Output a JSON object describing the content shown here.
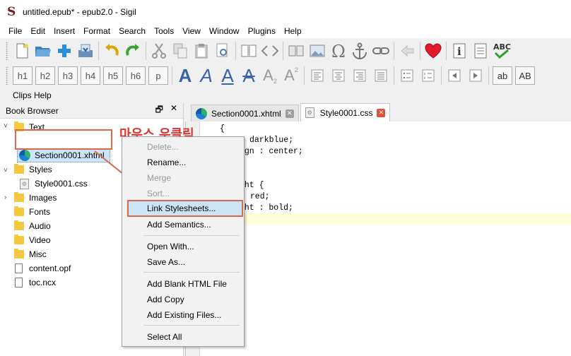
{
  "window": {
    "title": "untitled.epub* - epub2.0 - Sigil",
    "app_icon": "S"
  },
  "menubar": [
    "File",
    "Edit",
    "Insert",
    "Format",
    "Search",
    "Tools",
    "View",
    "Window",
    "Plugins",
    "Help"
  ],
  "toolbar2": {
    "headings": [
      "h1",
      "h2",
      "h3",
      "h4",
      "h5",
      "h6",
      "p"
    ],
    "a_glyph": "A",
    "sub_label": "2",
    "sup_label": "2",
    "ab_labels": [
      "ab",
      "AB"
    ]
  },
  "clips_bar": {
    "label": "Clips Help"
  },
  "book_browser": {
    "title": "Book Browser",
    "float_icon": "Ὕ7",
    "close_icon": "✕",
    "items": [
      {
        "label": "Text",
        "kind": "folder"
      },
      {
        "label": "Section0001.xhtml",
        "kind": "xhtml"
      },
      {
        "label": "Styles",
        "kind": "folder"
      },
      {
        "label": "Style0001.css",
        "kind": "css"
      },
      {
        "label": "Images",
        "kind": "folder"
      },
      {
        "label": "Fonts",
        "kind": "folder"
      },
      {
        "label": "Audio",
        "kind": "folder"
      },
      {
        "label": "Video",
        "kind": "folder"
      },
      {
        "label": "Misc",
        "kind": "folder"
      },
      {
        "label": "content.opf",
        "kind": "file"
      },
      {
        "label": "toc.ncx",
        "kind": "file"
      }
    ]
  },
  "tabs": [
    {
      "label": "Section0001.xhtml",
      "active": false
    },
    {
      "label": "Style0001.css",
      "active": true
    }
  ],
  "editor": {
    "lines": [
      "{",
      "darkblue;",
      "ign : center;",
      "",
      "",
      "ght {",
      " red;",
      "ght : bold;"
    ]
  },
  "context_menu": {
    "items": [
      {
        "label": "Delete...",
        "disabled": true
      },
      {
        "label": "Rename...",
        "disabled": false
      },
      {
        "label": "Merge",
        "disabled": true
      },
      {
        "label": "Sort...",
        "disabled": true
      },
      {
        "label": "Link Stylesheets...",
        "disabled": false,
        "selected": true
      },
      {
        "label": "Add Semantics...",
        "disabled": false
      },
      {
        "label": "Open With...",
        "disabled": false
      },
      {
        "label": "Save As...",
        "disabled": false
      },
      {
        "label": "Add Blank HTML File",
        "disabled": false
      },
      {
        "label": "Add Copy",
        "disabled": false
      },
      {
        "label": "Add Existing Files...",
        "disabled": false
      },
      {
        "label": "Select All",
        "disabled": false
      }
    ]
  },
  "annotation": {
    "label": "마우스 우클릭",
    "color": "#d86a49"
  }
}
